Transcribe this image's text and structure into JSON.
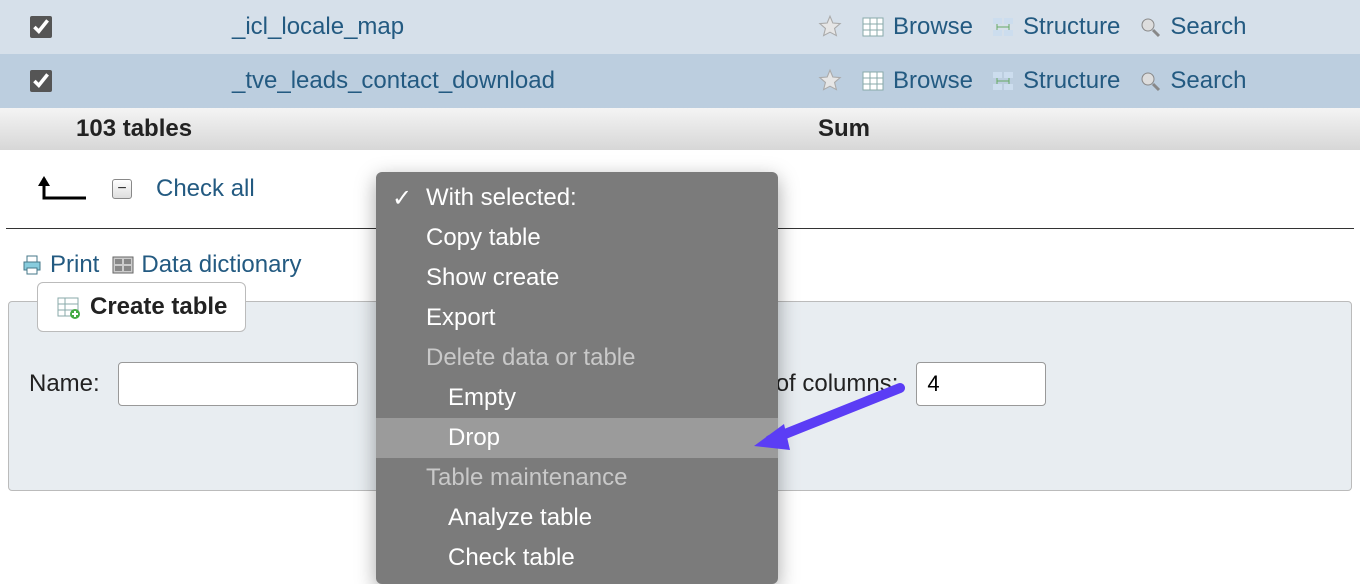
{
  "rows": [
    {
      "name": "_icl_locale_map",
      "checked": true
    },
    {
      "name": "_tve_leads_contact_download",
      "checked": true
    }
  ],
  "actions": {
    "browse": "Browse",
    "structure": "Structure",
    "search": "Search"
  },
  "summary": {
    "count_label": "103 tables",
    "sum_label": "Sum"
  },
  "toolbar": {
    "check_all": "Check all"
  },
  "tools": {
    "print": "Print",
    "data_dictionary": "Data dictionary"
  },
  "create": {
    "button": "Create table",
    "name_label": "Name:",
    "name_value": "",
    "ncol_label": "of columns:",
    "ncol_value": "4"
  },
  "dropdown": {
    "with_selected": "With selected:",
    "copy_table": "Copy table",
    "show_create": "Show create",
    "export": "Export",
    "group_delete": "Delete data or table",
    "empty": "Empty",
    "drop": "Drop",
    "group_maint": "Table maintenance",
    "analyze": "Analyze table",
    "check_table": "Check table"
  }
}
